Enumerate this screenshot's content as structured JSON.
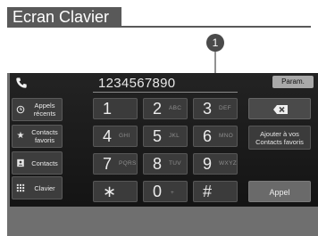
{
  "header": {
    "title": "Ecran Clavier"
  },
  "callout": {
    "number": "1"
  },
  "phone": {
    "number_display": "1234567890",
    "param_label": "Param."
  },
  "sidebar": {
    "items": [
      {
        "label": "Appels récents",
        "icon": "history-clock-icon"
      },
      {
        "label": "Contacts favoris",
        "icon": "star-icon"
      },
      {
        "label": "Contacts",
        "icon": "contacts-book-icon"
      },
      {
        "label": "Clavier",
        "icon": "keypad-grid-icon"
      }
    ]
  },
  "keypad": {
    "keys": [
      {
        "digit": "1",
        "letters": ""
      },
      {
        "digit": "2",
        "letters": "ABC"
      },
      {
        "digit": "3",
        "letters": "DEF"
      },
      {
        "digit": "4",
        "letters": "GHI"
      },
      {
        "digit": "5",
        "letters": "JKL"
      },
      {
        "digit": "6",
        "letters": "MNO"
      },
      {
        "digit": "7",
        "letters": "PQRS"
      },
      {
        "digit": "8",
        "letters": "TUV"
      },
      {
        "digit": "9",
        "letters": "WXYZ"
      },
      {
        "digit": "∗",
        "letters": ""
      },
      {
        "digit": "0",
        "letters": "+"
      },
      {
        "digit": "#",
        "letters": ""
      }
    ]
  },
  "actions": {
    "delete_icon": "backspace-icon",
    "add_contact_label": "Ajouter à vos Contacts favoris",
    "call_label": "Appel"
  },
  "colors": {
    "screen_bg": "#1a1a1a",
    "key_bg": "#3b3b3b",
    "title_bg": "#595959"
  }
}
